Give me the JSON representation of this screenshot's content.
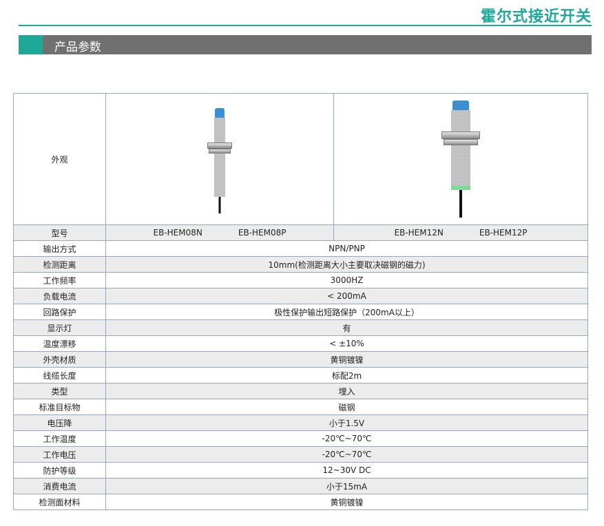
{
  "header": {
    "brand_title": "霍尔式接近开关",
    "section_label": "产品参数"
  },
  "table": {
    "appearance_label": "外观",
    "model_label": "型号",
    "models": {
      "m8n": "EB-HEM08N",
      "m8p": "EB-HEM08P",
      "m12n": "EB-HEM12N",
      "m12p": "EB-HEM12P"
    },
    "rows": [
      {
        "label": "输出方式",
        "value": "NPN/PNP"
      },
      {
        "label": "检测距离",
        "value": "10mm(检测距离大小主要取决磁钢的磁力)"
      },
      {
        "label": "工作频率",
        "value": "3000HZ"
      },
      {
        "label": "负载电流",
        "value": "< 200mA"
      },
      {
        "label": "回路保护",
        "value": "极性保护输出短路保护（200mA以上）"
      },
      {
        "label": "显示灯",
        "value": "有"
      },
      {
        "label": "温度漂移",
        "value": "< ±10%"
      },
      {
        "label": "外壳材质",
        "value": "黄铜镀镍"
      },
      {
        "label": "线缆长度",
        "value": "标配2m"
      },
      {
        "label": "类型",
        "value": "埋入"
      },
      {
        "label": "标准目标物",
        "value": "磁钢"
      },
      {
        "label": "电压降",
        "value": "小于1.5V"
      },
      {
        "label": "工作温度",
        "value": "-20℃~70℃"
      },
      {
        "label": "工作电压",
        "value": "-20℃~70℃"
      },
      {
        "label": "防护等级",
        "value": "12~30V DC"
      },
      {
        "label": "消费电流",
        "value": "小于15mA"
      },
      {
        "label": "检测面材料",
        "value": "黄铜镀镍"
      }
    ]
  },
  "colors": {
    "accent": "#1ea89a",
    "section_bar": "#707070",
    "border": "#8ea9c6",
    "row_shade": "#ececec",
    "sensor_cap": "#3b8ed0"
  }
}
